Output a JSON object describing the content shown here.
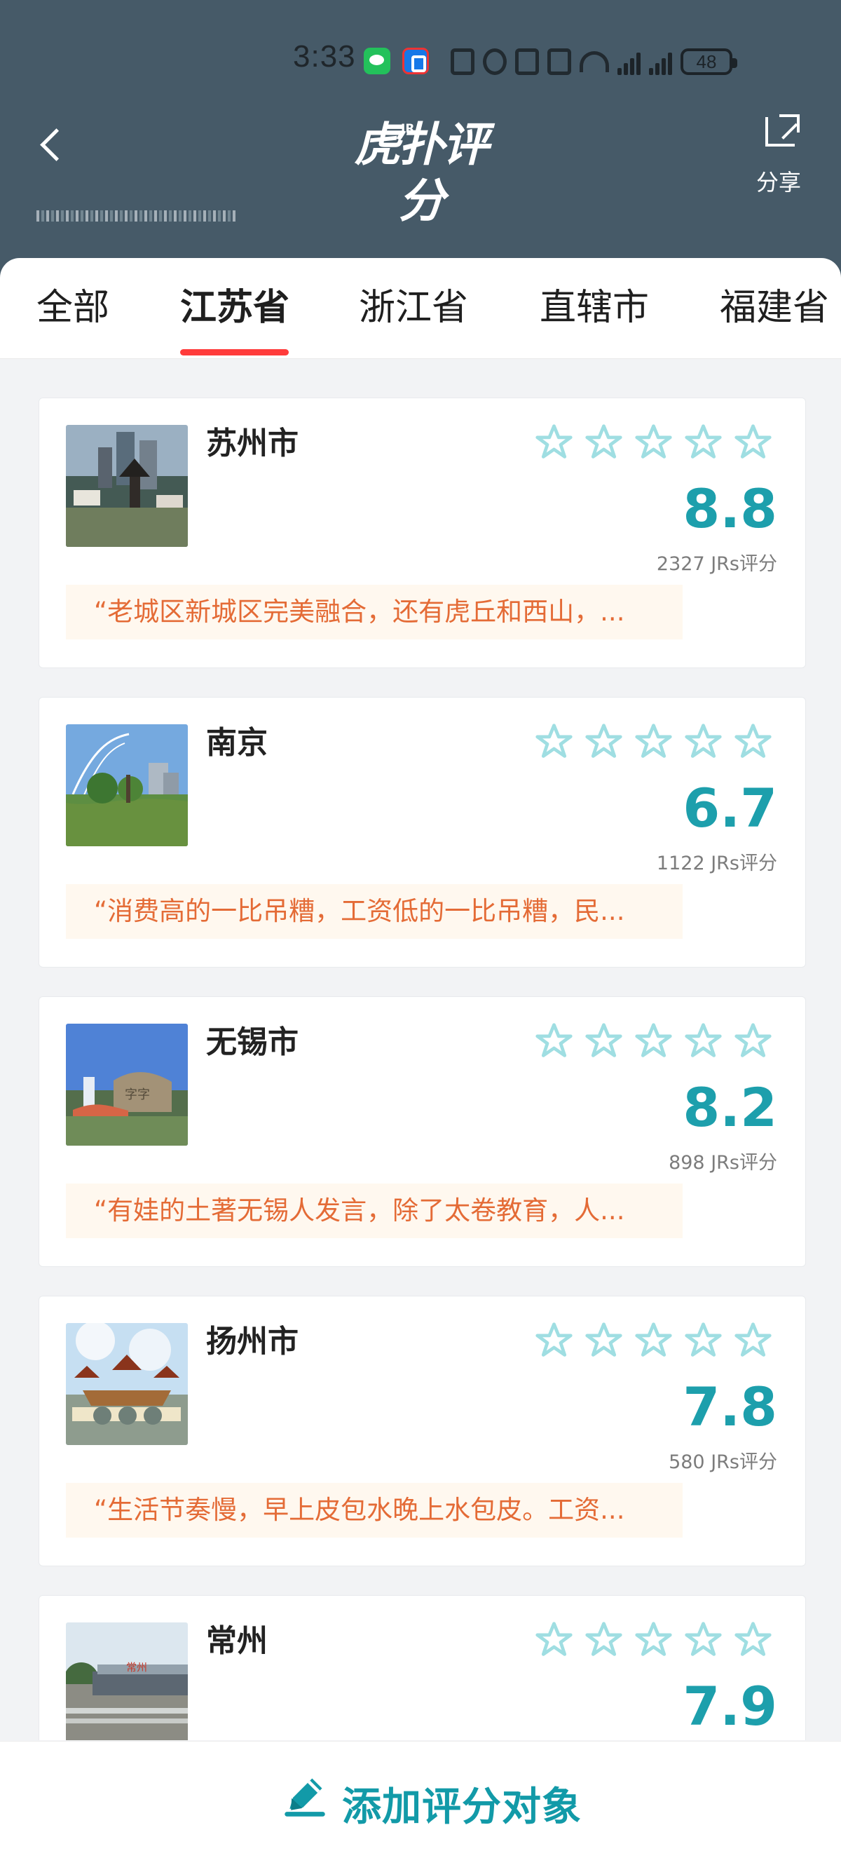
{
  "status_bar": {
    "time": "3:33",
    "battery": "48",
    "icons": [
      "wechat-icon",
      "app-notification-icon",
      "nfc-icon",
      "alarm-icon",
      "vibrate-icon",
      "mute-icon",
      "wifi-icon",
      "4g-signal-icon",
      "5g-signal-icon",
      "battery-icon"
    ]
  },
  "header": {
    "title": "虎扑评分",
    "logo_mark": "JR",
    "share_label": "分享",
    "colors": {
      "background": "#465a68",
      "accent": "#1d9fac",
      "tab_underline": "#ff3b3b",
      "quote_text": "#e46b36"
    }
  },
  "tabs": [
    {
      "label": "全部",
      "selected": false
    },
    {
      "label": "江苏省",
      "selected": true
    },
    {
      "label": "浙江省",
      "selected": false
    },
    {
      "label": "直辖市",
      "selected": false
    },
    {
      "label": "福建省",
      "selected": false
    }
  ],
  "items": [
    {
      "name": "苏州市",
      "score": "8.8",
      "count": "2327 JRs评分",
      "quote": "“老城区新城区完美融合，还有虎丘和西山，..."
    },
    {
      "name": "南京",
      "score": "6.7",
      "count": "1122 JRs评分",
      "quote": "“消费高的一比吊糟，工资低的一比吊糟，民..."
    },
    {
      "name": "无锡市",
      "score": "8.2",
      "count": "898 JRs评分",
      "quote": "“有娃的土著无锡人发言，除了太卷教育，人..."
    },
    {
      "name": "扬州市",
      "score": "7.8",
      "count": "580 JRs评分",
      "quote": "“生活节奏慢，早上皮包水晚上水包皮。工资..."
    },
    {
      "name": "常州",
      "score": "7.9",
      "count": "",
      "quote": ""
    }
  ],
  "bottom_action": {
    "label": "添加评分对象",
    "icon": "pencil-icon"
  }
}
